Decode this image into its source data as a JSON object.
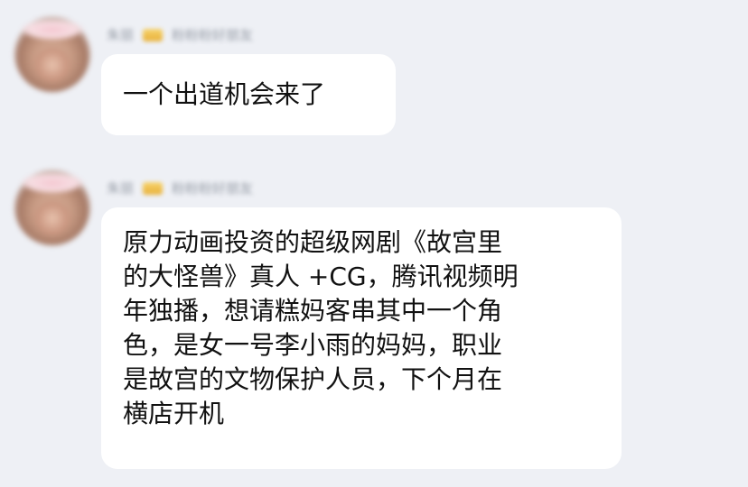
{
  "messages": [
    {
      "sender_name": "朱丽",
      "sender_title": "粉粉粉好朋友",
      "text": "一个出道机会来了"
    },
    {
      "sender_name": "朱丽",
      "sender_title": "粉粉粉好朋友",
      "text": "原力动画投资的超级网剧《故宫里\n的大怪兽》真人 +CG，腾讯视频明\n年独播，想请糕妈客串其中一个角\n色，是女一号李小雨的妈妈，职业\n是故宫的文物保护人员，下个月在\n横店开机"
    }
  ],
  "colors": {
    "background": "#eef0f5",
    "bubble": "#ffffff",
    "text": "#111111"
  }
}
